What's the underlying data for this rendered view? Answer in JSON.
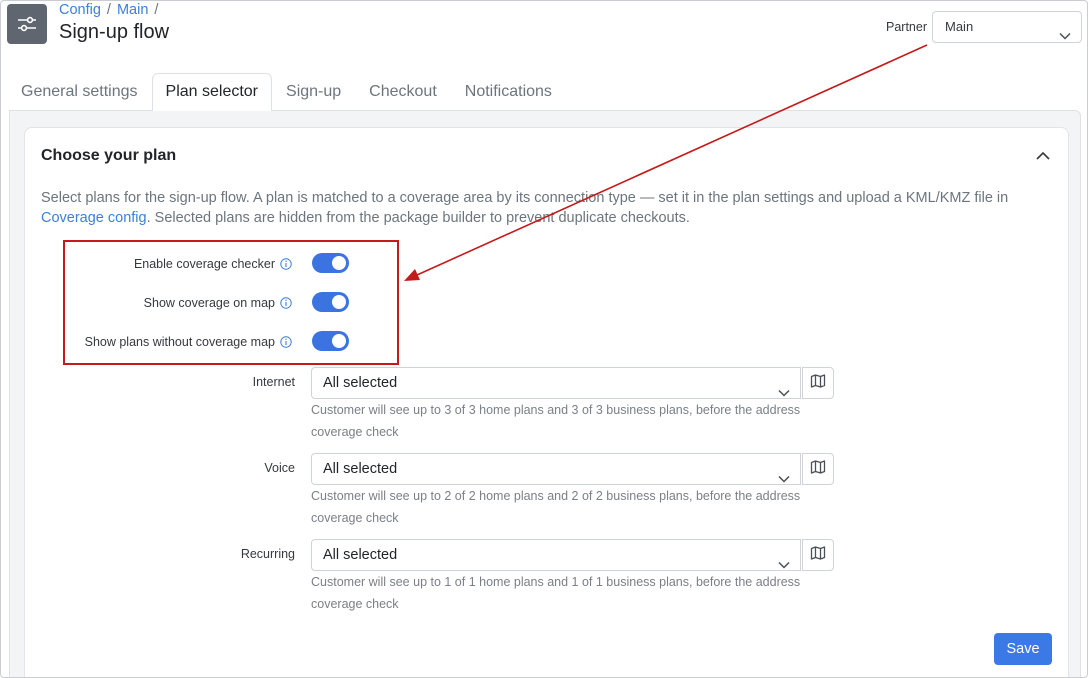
{
  "header": {
    "breadcrumb": [
      "Config",
      "Main"
    ],
    "breadcrumb_separator": "/",
    "title": "Sign-up flow",
    "partner_label": "Partner",
    "partner_value": "Main"
  },
  "tabs": [
    {
      "label": "General settings",
      "active": false
    },
    {
      "label": "Plan selector",
      "active": true
    },
    {
      "label": "Sign-up",
      "active": false
    },
    {
      "label": "Checkout",
      "active": false
    },
    {
      "label": "Notifications",
      "active": false
    }
  ],
  "card": {
    "title": "Choose your plan",
    "description_before_link": "Select plans for the sign-up flow. A plan is matched to a coverage area by its connection type — set it in the plan settings and upload a KML/KMZ file in",
    "description_link": "Coverage config",
    "description_after_link": ". Selected plans are hidden from the package builder to prevent duplicate checkouts."
  },
  "toggles": [
    {
      "label": "Enable coverage checker",
      "on": true
    },
    {
      "label": "Show coverage on map",
      "on": true
    },
    {
      "label": "Show plans without coverage map",
      "on": true
    }
  ],
  "plan_types": [
    {
      "label": "Internet",
      "value": "All selected",
      "help_line1": "Customer will see up to 3 of 3 home plans and 3 of 3 business plans, before the address",
      "help_line2": "coverage check"
    },
    {
      "label": "Voice",
      "value": "All selected",
      "help_line1": "Customer will see up to 2 of 2 home plans and 2 of 2 business plans, before the address",
      "help_line2": "coverage check"
    },
    {
      "label": "Recurring",
      "value": "All selected",
      "help_line1": "Customer will see up to 1 of 1 home plans and 1 of 1 business plans, before the address",
      "help_line2": "coverage check"
    }
  ],
  "actions": {
    "save_label": "Save"
  },
  "colors": {
    "accent": "#3b74e0",
    "annotation": "#c41a1a",
    "link": "#3d7fd9"
  },
  "icons": {
    "app": "sliders-icon",
    "info": "info-icon",
    "map": "map-icon",
    "chevron": "chevron-down-icon",
    "collapse": "chevron-up-icon"
  }
}
